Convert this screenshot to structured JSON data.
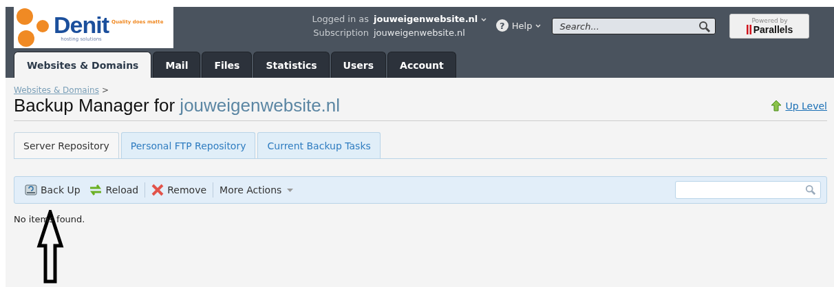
{
  "logo": {
    "name": "Denit",
    "subtitle": "hosting solutions",
    "slogan": "Quality does matte"
  },
  "account": {
    "logged_in_label": "Logged in as",
    "logged_in_value": "jouweigenwebsite.nl",
    "subscription_label": "Subscription",
    "subscription_value": "jouweigenwebsite.nl"
  },
  "help": {
    "icon": "?",
    "label": "Help"
  },
  "search": {
    "placeholder": "Search..."
  },
  "powered_by": {
    "caption": "Powered by",
    "brand": "Parallels"
  },
  "main_tabs": [
    {
      "label": "Websites & Domains",
      "selected": true
    },
    {
      "label": "Mail",
      "selected": false
    },
    {
      "label": "Files",
      "selected": false
    },
    {
      "label": "Statistics",
      "selected": false
    },
    {
      "label": "Users",
      "selected": false
    },
    {
      "label": "Account",
      "selected": false
    }
  ],
  "breadcrumb": [
    "Websites & Domains"
  ],
  "breadcrumb_separator": ">",
  "page_title": {
    "prefix": "Backup Manager for",
    "domain": "jouweigenwebsite.nl"
  },
  "up_level": "Up Level",
  "sub_tabs": [
    {
      "label": "Server Repository",
      "selected": true
    },
    {
      "label": "Personal FTP Repository",
      "selected": false
    },
    {
      "label": "Current Backup Tasks",
      "selected": false
    }
  ],
  "toolbar": [
    {
      "kind": "backup",
      "label": "Back Up"
    },
    {
      "kind": "reload",
      "label": "Reload"
    },
    {
      "kind": "remove",
      "label": "Remove"
    },
    {
      "kind": "more",
      "label": "More Actions"
    }
  ],
  "empty_message": "No items found."
}
